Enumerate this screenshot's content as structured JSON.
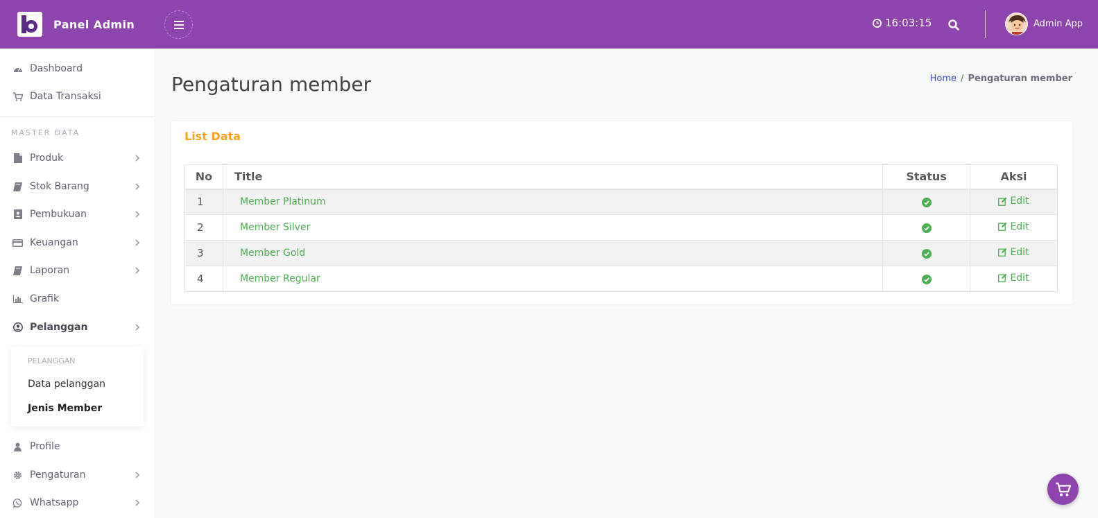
{
  "brand": {
    "name": "Panel Admin"
  },
  "header": {
    "time": "16:03:15",
    "user_name": "Admin App"
  },
  "sidebar": {
    "items": [
      {
        "label": "Dashboard",
        "icon": "dashboard-icon"
      },
      {
        "label": "Data Transaksi",
        "icon": "cart-icon"
      }
    ],
    "section_label": "MASTER DATA",
    "master_items": [
      {
        "label": "Produk",
        "icon": "file-icon"
      },
      {
        "label": "Stok Barang",
        "icon": "book-icon"
      },
      {
        "label": "Pembukuan",
        "icon": "contact-book-icon"
      },
      {
        "label": "Keuangan",
        "icon": "credit-card-icon"
      },
      {
        "label": "Laporan",
        "icon": "book-icon"
      },
      {
        "label": "Grafik",
        "icon": "bar-chart-icon"
      },
      {
        "label": "Pelanggan",
        "icon": "user-circle-icon"
      }
    ],
    "submenu": {
      "header": "PELANGGAN",
      "items": [
        {
          "label": "Data pelanggan"
        },
        {
          "label": "Jenis Member"
        }
      ]
    },
    "bottom_items": [
      {
        "label": "Profile",
        "icon": "user-icon"
      },
      {
        "label": "Pengaturan",
        "icon": "gear-icon"
      },
      {
        "label": "Whatsapp",
        "icon": "whatsapp-icon"
      }
    ]
  },
  "page": {
    "title": "Pengaturan member",
    "breadcrumb": {
      "home": "Home",
      "separator": "/",
      "current": "Pengaturan member"
    }
  },
  "card": {
    "title": "List Data",
    "columns": {
      "no": "No",
      "title": "Title",
      "status": "Status",
      "aksi": "Aksi"
    },
    "rows": [
      {
        "no": "1",
        "title": "Member Platinum",
        "edit": "Edit"
      },
      {
        "no": "2",
        "title": "Member Silver",
        "edit": "Edit"
      },
      {
        "no": "3",
        "title": "Member Gold",
        "edit": "Edit"
      },
      {
        "no": "4",
        "title": "Member Regular",
        "edit": "Edit"
      }
    ]
  },
  "colors": {
    "primary": "#8d44ad",
    "accent": "#f9a21a",
    "success": "#4caf50",
    "link": "#3f51b5"
  }
}
